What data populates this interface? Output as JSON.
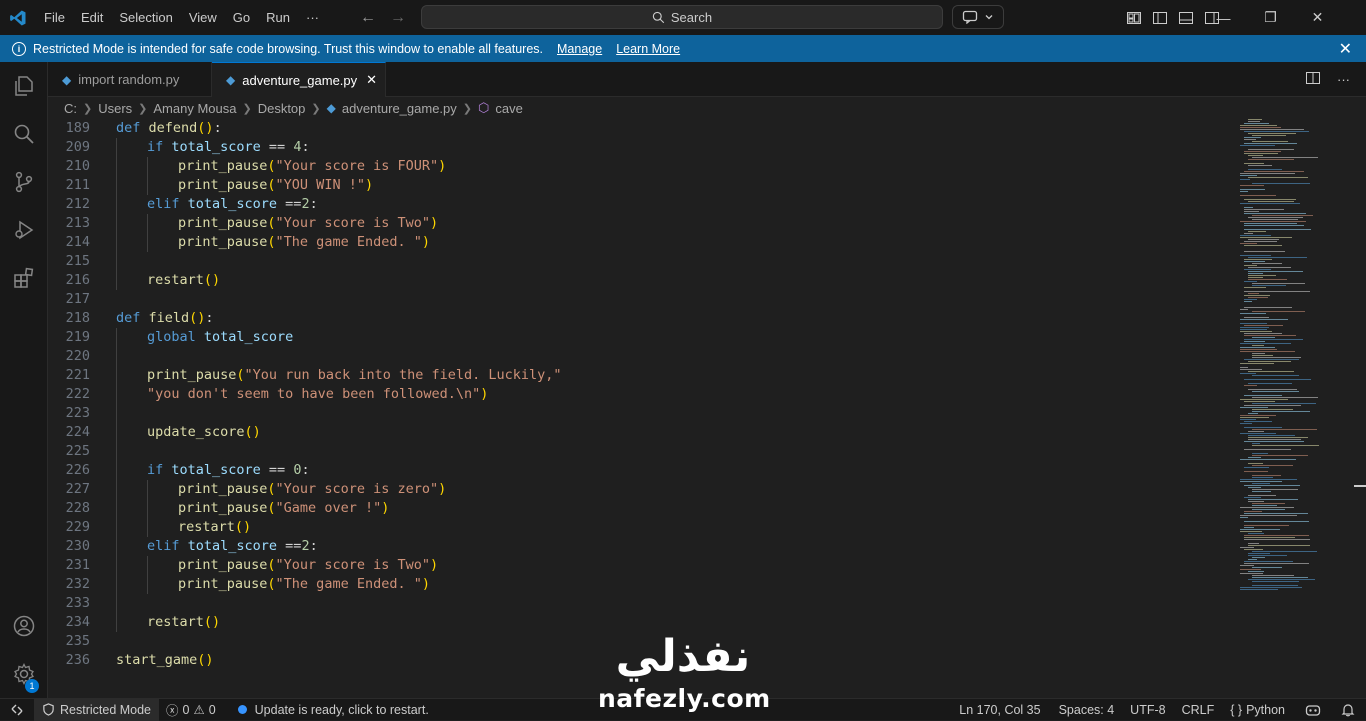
{
  "titlebar": {
    "menu": [
      "File",
      "Edit",
      "Selection",
      "View",
      "Go",
      "Run",
      "···"
    ],
    "search_label": "Search"
  },
  "banner": {
    "message": "Restricted Mode is intended for safe code browsing. Trust this window to enable all features.",
    "manage_label": "Manage",
    "learn_more_label": "Learn More"
  },
  "tabs": [
    {
      "label": "import random.py",
      "active": false
    },
    {
      "label": "adventure_game.py",
      "active": true
    }
  ],
  "breadcrumb": {
    "parts": [
      "C:",
      "Users",
      "Amany Mousa",
      "Desktop",
      "adventure_game.py",
      "cave"
    ]
  },
  "editor": {
    "lines": [
      {
        "n": "189",
        "indent": 0,
        "tokens": [
          [
            "kw",
            "def "
          ],
          [
            "fn",
            "defend"
          ],
          [
            "paren",
            "()"
          ],
          [
            "plain",
            ":"
          ]
        ]
      },
      {
        "n": "209",
        "indent": 1,
        "tokens": [
          [
            "kw",
            "if "
          ],
          [
            "var",
            "total_score"
          ],
          [
            "plain",
            " == "
          ],
          [
            "num",
            "4"
          ],
          [
            "plain",
            ":"
          ]
        ]
      },
      {
        "n": "210",
        "indent": 2,
        "tokens": [
          [
            "fn",
            "print_pause"
          ],
          [
            "paren",
            "("
          ],
          [
            "str",
            "\"Your score is FOUR\""
          ],
          [
            "paren",
            ")"
          ]
        ]
      },
      {
        "n": "211",
        "indent": 2,
        "tokens": [
          [
            "fn",
            "print_pause"
          ],
          [
            "paren",
            "("
          ],
          [
            "str",
            "\"YOU WIN !\""
          ],
          [
            "paren",
            ")"
          ]
        ]
      },
      {
        "n": "212",
        "indent": 1,
        "tokens": [
          [
            "kw",
            "elif "
          ],
          [
            "var",
            "total_score"
          ],
          [
            "plain",
            " =="
          ],
          [
            "num",
            "2"
          ],
          [
            "plain",
            ":"
          ]
        ]
      },
      {
        "n": "213",
        "indent": 2,
        "tokens": [
          [
            "fn",
            "print_pause"
          ],
          [
            "paren",
            "("
          ],
          [
            "str",
            "\"Your score is Two\""
          ],
          [
            "paren",
            ")"
          ]
        ]
      },
      {
        "n": "214",
        "indent": 2,
        "tokens": [
          [
            "fn",
            "print_pause"
          ],
          [
            "paren",
            "("
          ],
          [
            "str",
            "\"The game Ended. \""
          ],
          [
            "paren",
            ")"
          ]
        ]
      },
      {
        "n": "215",
        "indent": 0,
        "tokens": []
      },
      {
        "n": "216",
        "indent": 1,
        "tokens": [
          [
            "fn",
            "restart"
          ],
          [
            "paren",
            "()"
          ]
        ]
      },
      {
        "n": "217",
        "indent": 0,
        "tokens": []
      },
      {
        "n": "218",
        "indent": 0,
        "tokens": [
          [
            "kw",
            "def "
          ],
          [
            "fn",
            "field"
          ],
          [
            "paren",
            "()"
          ],
          [
            "plain",
            ":"
          ]
        ]
      },
      {
        "n": "219",
        "indent": 1,
        "tokens": [
          [
            "kw",
            "global "
          ],
          [
            "var",
            "total_score"
          ]
        ]
      },
      {
        "n": "220",
        "indent": 0,
        "tokens": []
      },
      {
        "n": "221",
        "indent": 1,
        "tokens": [
          [
            "fn",
            "print_pause"
          ],
          [
            "paren",
            "("
          ],
          [
            "str",
            "\"You run back into the field. Luckily,\""
          ]
        ]
      },
      {
        "n": "222",
        "indent": 1,
        "tokens": [
          [
            "str",
            "\"you don't seem to have been followed.\\n\""
          ],
          [
            "paren",
            ")"
          ]
        ]
      },
      {
        "n": "223",
        "indent": 0,
        "tokens": []
      },
      {
        "n": "224",
        "indent": 1,
        "tokens": [
          [
            "fn",
            "update_score"
          ],
          [
            "paren",
            "()"
          ]
        ]
      },
      {
        "n": "225",
        "indent": 0,
        "tokens": []
      },
      {
        "n": "226",
        "indent": 1,
        "tokens": [
          [
            "kw",
            "if "
          ],
          [
            "var",
            "total_score"
          ],
          [
            "plain",
            " == "
          ],
          [
            "num",
            "0"
          ],
          [
            "plain",
            ":"
          ]
        ]
      },
      {
        "n": "227",
        "indent": 2,
        "tokens": [
          [
            "fn",
            "print_pause"
          ],
          [
            "paren",
            "("
          ],
          [
            "str",
            "\"Your score is zero\""
          ],
          [
            "paren",
            ")"
          ]
        ]
      },
      {
        "n": "228",
        "indent": 2,
        "tokens": [
          [
            "fn",
            "print_pause"
          ],
          [
            "paren",
            "("
          ],
          [
            "str",
            "\"Game over !\""
          ],
          [
            "paren",
            ")"
          ]
        ]
      },
      {
        "n": "229",
        "indent": 2,
        "tokens": [
          [
            "fn",
            "restart"
          ],
          [
            "paren",
            "()"
          ]
        ]
      },
      {
        "n": "230",
        "indent": 1,
        "tokens": [
          [
            "kw",
            "elif "
          ],
          [
            "var",
            "total_score"
          ],
          [
            "plain",
            " =="
          ],
          [
            "num",
            "2"
          ],
          [
            "plain",
            ":"
          ]
        ]
      },
      {
        "n": "231",
        "indent": 2,
        "tokens": [
          [
            "fn",
            "print_pause"
          ],
          [
            "paren",
            "("
          ],
          [
            "str",
            "\"Your score is Two\""
          ],
          [
            "paren",
            ")"
          ]
        ]
      },
      {
        "n": "232",
        "indent": 2,
        "tokens": [
          [
            "fn",
            "print_pause"
          ],
          [
            "paren",
            "("
          ],
          [
            "str",
            "\"The game Ended. \""
          ],
          [
            "paren",
            ")"
          ]
        ]
      },
      {
        "n": "233",
        "indent": 0,
        "tokens": []
      },
      {
        "n": "234",
        "indent": 1,
        "tokens": [
          [
            "fn",
            "restart"
          ],
          [
            "paren",
            "()"
          ]
        ]
      },
      {
        "n": "235",
        "indent": 0,
        "tokens": []
      },
      {
        "n": "236",
        "indent": 0,
        "tokens": [
          [
            "fn",
            "start_game"
          ],
          [
            "paren",
            "()"
          ]
        ]
      }
    ]
  },
  "statusbar": {
    "restricted_mode": "Restricted Mode",
    "errors": "0",
    "warnings": "0",
    "update_message": "Update is ready, click to restart.",
    "position": "Ln 170, Col 35",
    "spaces": "Spaces: 4",
    "encoding": "UTF-8",
    "eol": "CRLF",
    "language": "Python"
  },
  "activity_bar": {
    "icons": [
      "explorer-icon",
      "search-icon",
      "source-control-icon",
      "run-debug-icon",
      "extensions-icon",
      "account-icon",
      "settings-gear-icon"
    ],
    "settings_badge": "1"
  },
  "watermark": {
    "arabic": "نفذلي",
    "latin": "nafezly.com"
  },
  "colors": {
    "accent": "#0078d4",
    "banner": "#0e639c",
    "keyword": "#569cd6",
    "function": "#dcdcaa",
    "variable": "#9cdcfe",
    "string": "#ce9178",
    "number": "#b5cea8"
  }
}
